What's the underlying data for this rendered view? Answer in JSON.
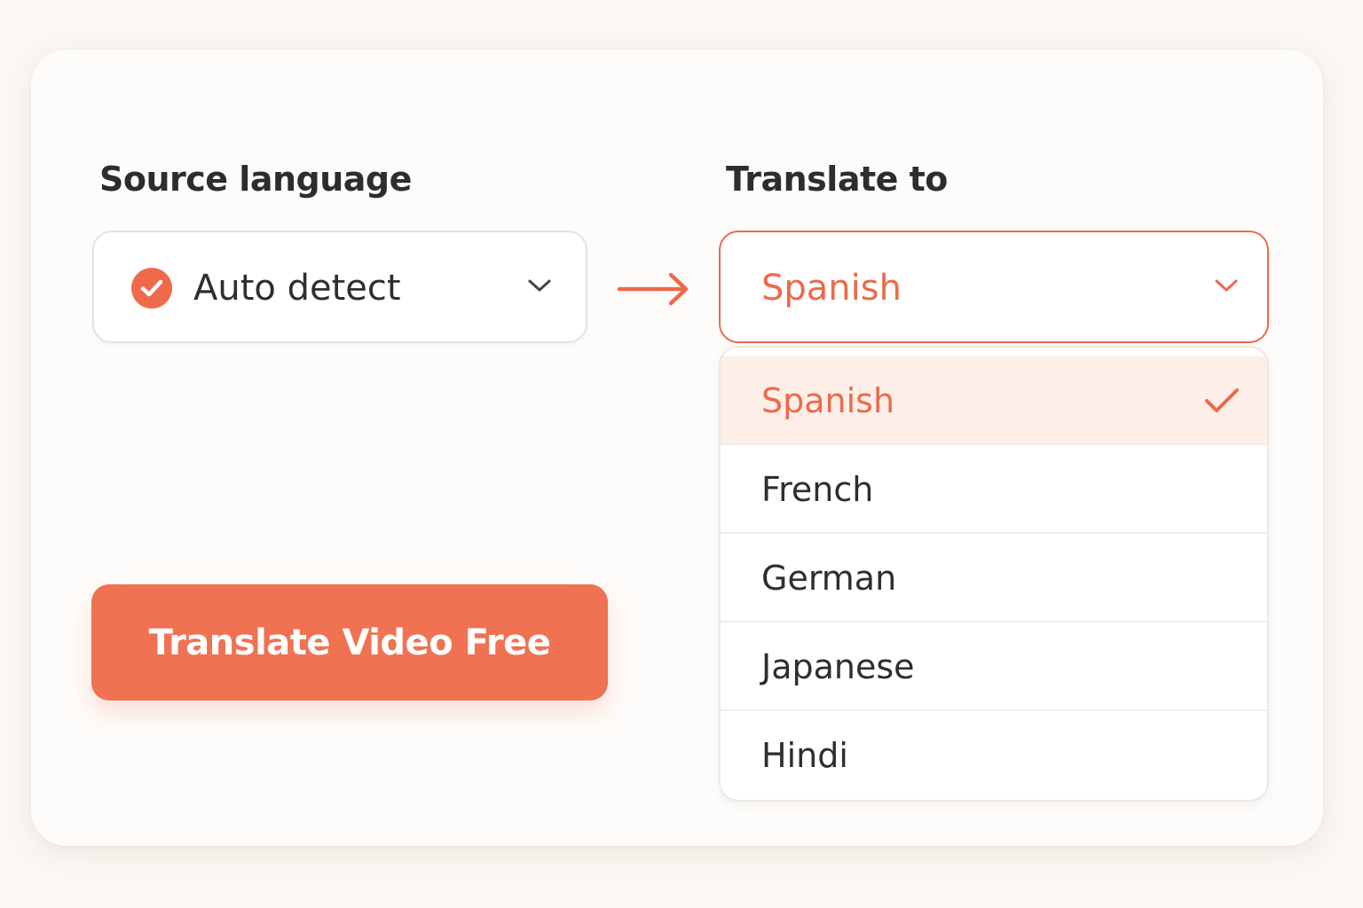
{
  "source": {
    "label": "Source language",
    "selected_value": "Auto detect",
    "status_icon": "check-circle-icon",
    "chevron_icon": "chevron-down-icon"
  },
  "direction_icon": "arrow-right-icon",
  "target": {
    "label": "Translate to",
    "selected_value": "Spanish",
    "chevron_icon": "chevron-down-icon",
    "options": [
      {
        "label": "Spanish",
        "selected": true
      },
      {
        "label": "French",
        "selected": false
      },
      {
        "label": "German",
        "selected": false
      },
      {
        "label": "Japanese",
        "selected": false
      },
      {
        "label": "Hindi",
        "selected": false
      }
    ]
  },
  "cta": {
    "label": "Translate Video Free"
  },
  "colors": {
    "accent": "#ec6a4a",
    "button": "#ef7253",
    "selected_row": "#fdeee8",
    "page_background": "#fbf7f3",
    "card_background": "#fefcfa",
    "text": "#2e2e2e"
  }
}
